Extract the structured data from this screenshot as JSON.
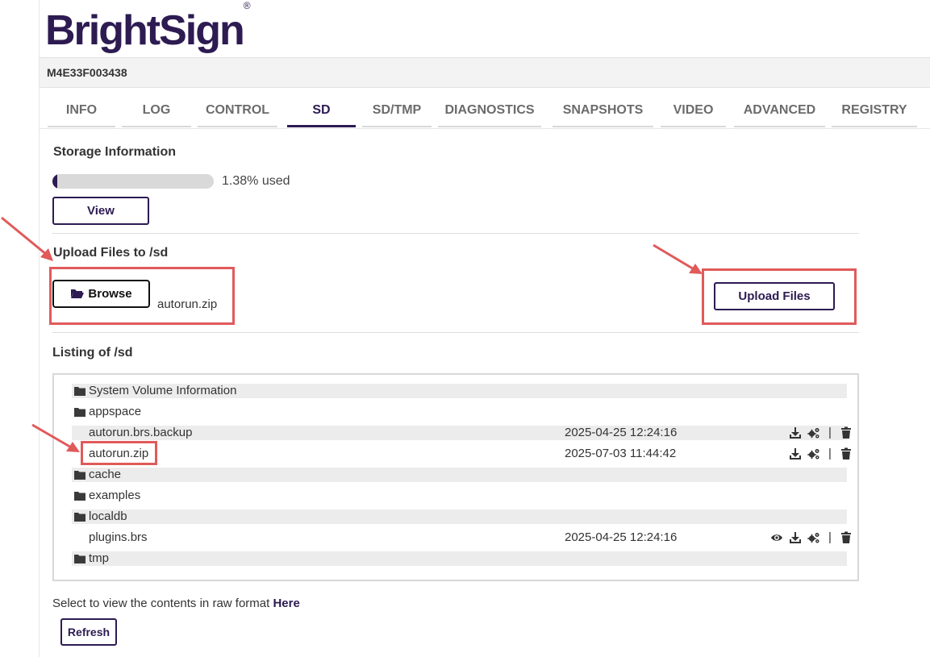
{
  "brand": {
    "logo_text": "BrightSign",
    "reg_mark": "®"
  },
  "device": {
    "serial": "M4E33F003438"
  },
  "tabs": [
    {
      "label": "INFO",
      "active": false
    },
    {
      "label": "LOG",
      "active": false
    },
    {
      "label": "CONTROL",
      "active": false
    },
    {
      "label": "SD",
      "active": true
    },
    {
      "label": "SD/TMP",
      "active": false
    },
    {
      "label": "DIAGNOSTICS",
      "active": false
    },
    {
      "label": "SNAPSHOTS",
      "active": false
    },
    {
      "label": "VIDEO",
      "active": false
    },
    {
      "label": "ADVANCED",
      "active": false
    },
    {
      "label": "REGISTRY",
      "active": false
    }
  ],
  "storage": {
    "title": "Storage Information",
    "used_percent": 1.38,
    "used_text": "1.38% used",
    "view_label": "View"
  },
  "upload": {
    "title": "Upload Files to /sd",
    "browse_label": "Browse",
    "selected_file": "autorun.zip",
    "upload_label": "Upload Files"
  },
  "listing": {
    "title": "Listing of /sd",
    "entries": [
      {
        "type": "folder",
        "name": "System Volume Information",
        "date": ""
      },
      {
        "type": "folder",
        "name": "appspace",
        "date": ""
      },
      {
        "type": "file",
        "name": "autorun.brs.backup",
        "date": "2025-04-25 12:24:16",
        "viewable": false
      },
      {
        "type": "file",
        "name": "autorun.zip",
        "date": "2025-07-03 11:44:42",
        "viewable": false
      },
      {
        "type": "folder",
        "name": "cache",
        "date": ""
      },
      {
        "type": "folder",
        "name": "examples",
        "date": ""
      },
      {
        "type": "folder",
        "name": "localdb",
        "date": ""
      },
      {
        "type": "file",
        "name": "plugins.brs",
        "date": "2025-04-25 12:24:16",
        "viewable": true
      },
      {
        "type": "folder",
        "name": "tmp",
        "date": ""
      }
    ]
  },
  "raw": {
    "text": "Select to view the contents in raw format",
    "link_label": "Here"
  },
  "refresh_label": "Refresh",
  "icons": {
    "folder": "folder-icon",
    "download": "download-icon",
    "settings": "gears-icon",
    "delete": "trash-icon",
    "view": "eye-icon"
  },
  "colors": {
    "brand": "#2d1b52",
    "highlight": "#e05a5a",
    "row_shade": "#ececec"
  }
}
